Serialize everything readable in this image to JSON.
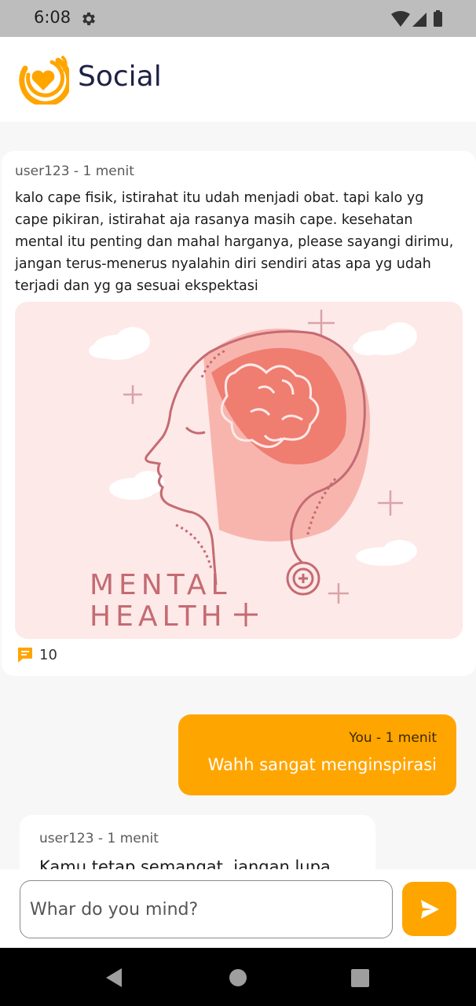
{
  "status_bar": {
    "time": "6:08",
    "icons": [
      "gear-icon",
      "wifi-icon",
      "signal-icon",
      "battery-icon"
    ]
  },
  "header": {
    "title": "Social",
    "logo_icon": "heart-logo-icon"
  },
  "post": {
    "meta": "user123 - 1 menit",
    "text": "kalo cape fisik, istirahat itu udah menjadi obat. tapi kalo yg cape pikiran, istirahat aja rasanya masih cape. kesehatan mental itu penting dan mahal harganya, please sayangi dirimu, jangan terus-menerus nyalahin diri sendiri atas apa yg udah terjadi dan yg ga sesuai ekspektasi",
    "image_caption_line1": "MENTAL",
    "image_caption_line2": "HEALTH",
    "comment_count": "10"
  },
  "comments": [
    {
      "meta": "You - 1 menit",
      "text": "Wahh sangat menginspirasi",
      "is_me": true
    },
    {
      "meta": "user123 - 1 menit",
      "text": "Kamu tetap semangat, jangan lupa",
      "is_me": false
    }
  ],
  "composer": {
    "placeholder": "Whar do you mind?"
  },
  "colors": {
    "accent": "#FFA500",
    "title": "#1E2146",
    "illustration_bg": "#FDE9E8",
    "illustration_line": "#C46B73"
  }
}
